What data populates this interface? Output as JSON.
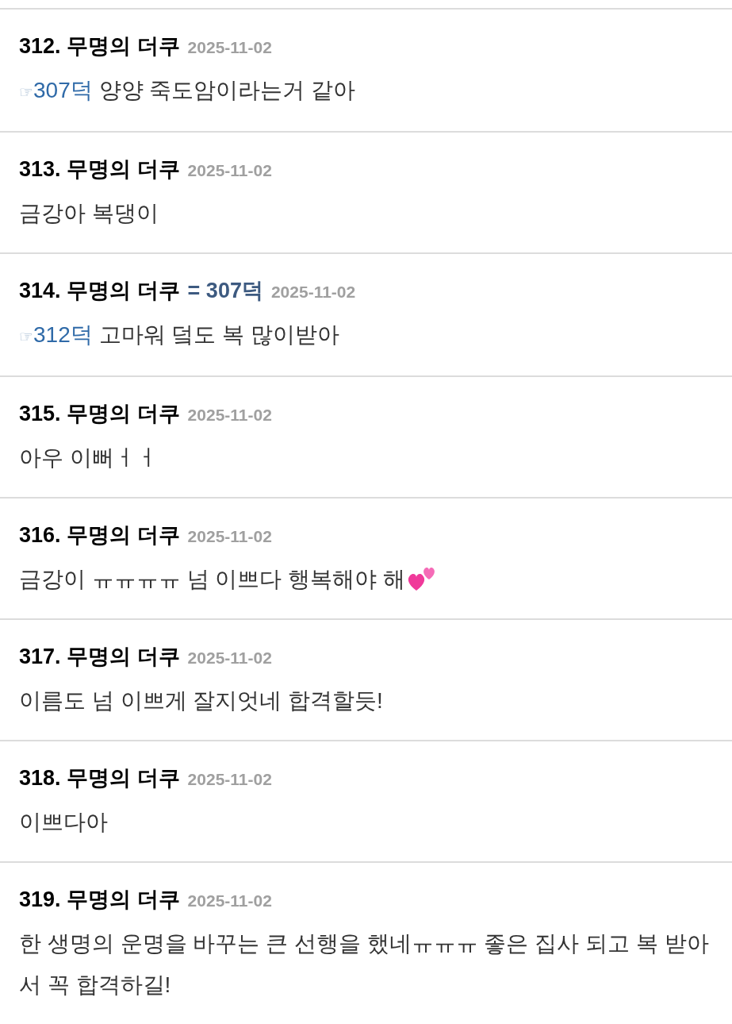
{
  "comments": [
    {
      "number": "312.",
      "author": "무명의 더쿠",
      "date": "2025-11-02",
      "ref_icon": "☞",
      "ref": "307덕",
      "text": "양양 죽도암이라는거 같아"
    },
    {
      "number": "313.",
      "author": "무명의 더쿠",
      "date": "2025-11-02",
      "text": "금강아 복댕이"
    },
    {
      "number": "314.",
      "author": "무명의 더쿠",
      "author_tag": "= 307덕",
      "date": "2025-11-02",
      "ref_icon": "☞",
      "ref": "312덕",
      "text": "고마워 덬도 복 많이받아"
    },
    {
      "number": "315.",
      "author": "무명의 더쿠",
      "date": "2025-11-02",
      "text": "아우 이뻐ㅓㅓ"
    },
    {
      "number": "316.",
      "author": "무명의 더쿠",
      "date": "2025-11-02",
      "text": "금강이 ㅠㅠㅠㅠ 넘 이쁘다 행복해야 해",
      "has_emoji": true
    },
    {
      "number": "317.",
      "author": "무명의 더쿠",
      "date": "2025-11-02",
      "text": "이름도 넘 이쁘게 잘지엇네 합격할듯!"
    },
    {
      "number": "318.",
      "author": "무명의 더쿠",
      "date": "2025-11-02",
      "text": "이쁘다아"
    },
    {
      "number": "319.",
      "author": "무명의 더쿠",
      "date": "2025-11-02",
      "text": "한 생명의 운명을 바꾸는 큰 선행을 했네ㅠㅠㅠ 좋은 집사 되고 복 받아서 꼭 합격하길!"
    }
  ]
}
